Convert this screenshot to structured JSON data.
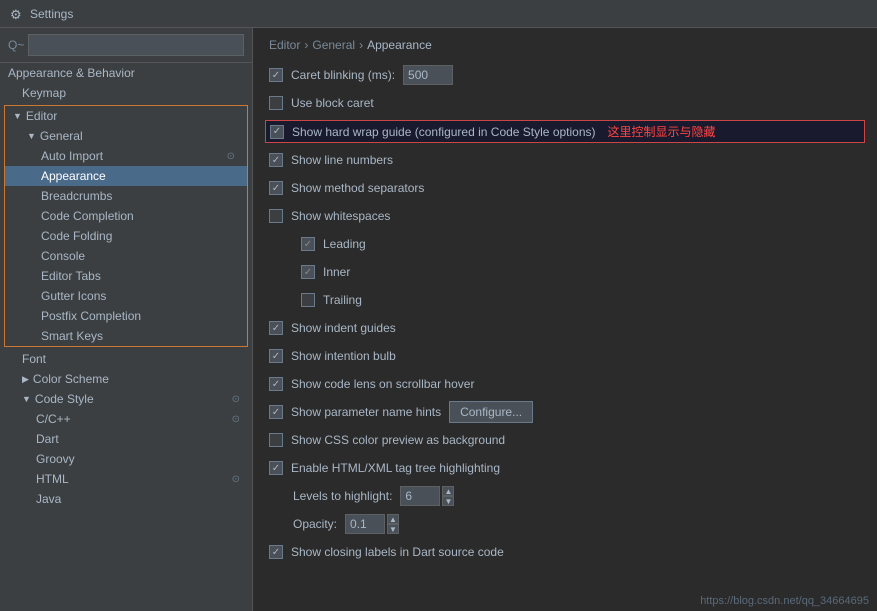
{
  "titleBar": {
    "title": "Settings",
    "icon": "⚙"
  },
  "sidebar": {
    "searchPlaceholder": "Q~",
    "items": [
      {
        "id": "appearance-behavior",
        "label": "Appearance & Behavior",
        "level": 0,
        "expanded": true,
        "hasArrow": false
      },
      {
        "id": "keymap",
        "label": "Keymap",
        "level": 1,
        "hasArrow": false
      },
      {
        "id": "editor",
        "label": "Editor",
        "level": 0,
        "expanded": true,
        "hasArrow": true,
        "highlighted": true
      },
      {
        "id": "general",
        "label": "General",
        "level": 1,
        "expanded": true,
        "hasArrow": true
      },
      {
        "id": "auto-import",
        "label": "Auto Import",
        "level": 2,
        "hasArrow": false,
        "hasRightIcon": true
      },
      {
        "id": "appearance",
        "label": "Appearance",
        "level": 2,
        "selected": true
      },
      {
        "id": "breadcrumbs",
        "label": "Breadcrumbs",
        "level": 2
      },
      {
        "id": "code-completion",
        "label": "Code Completion",
        "level": 2
      },
      {
        "id": "code-folding",
        "label": "Code Folding",
        "level": 2
      },
      {
        "id": "console",
        "label": "Console",
        "level": 2
      },
      {
        "id": "editor-tabs",
        "label": "Editor Tabs",
        "level": 2
      },
      {
        "id": "gutter-icons",
        "label": "Gutter Icons",
        "level": 2
      },
      {
        "id": "postfix-completion",
        "label": "Postfix Completion",
        "level": 2
      },
      {
        "id": "smart-keys",
        "label": "Smart Keys",
        "level": 2
      },
      {
        "id": "font",
        "label": "Font",
        "level": 1
      },
      {
        "id": "color-scheme",
        "label": "Color Scheme",
        "level": 1,
        "hasArrow": false,
        "collapsed": true
      },
      {
        "id": "code-style",
        "label": "Code Style",
        "level": 1,
        "expanded": true,
        "hasArrow": true,
        "hasRightIcon": true
      },
      {
        "id": "cpp",
        "label": "C/C++",
        "level": 2,
        "hasRightIcon": true
      },
      {
        "id": "dart",
        "label": "Dart",
        "level": 2
      },
      {
        "id": "groovy",
        "label": "Groovy",
        "level": 2
      },
      {
        "id": "html",
        "label": "HTML",
        "level": 2,
        "hasRightIcon": true
      },
      {
        "id": "java",
        "label": "Java",
        "level": 2
      }
    ]
  },
  "content": {
    "breadcrumb": [
      "Editor",
      "General",
      "Appearance"
    ],
    "breadcrumbSeparator": "›",
    "settings": [
      {
        "id": "caret-blinking",
        "type": "checkbox-input",
        "checked": true,
        "label": "Caret blinking (ms):",
        "value": "500"
      },
      {
        "id": "use-block-caret",
        "type": "checkbox",
        "checked": false,
        "label": "Use block caret"
      },
      {
        "id": "show-hard-wrap",
        "type": "checkbox",
        "checked": true,
        "label": "Show hard wrap guide (configured in Code Style options)",
        "highlighted": true
      },
      {
        "id": "show-line-numbers",
        "type": "checkbox",
        "checked": true,
        "label": "Show line numbers"
      },
      {
        "id": "show-method-separators",
        "type": "checkbox",
        "checked": true,
        "label": "Show method separators"
      },
      {
        "id": "show-whitespaces",
        "type": "checkbox",
        "checked": false,
        "label": "Show whitespaces"
      },
      {
        "id": "leading",
        "type": "checkbox-sub",
        "checked": true,
        "label": "Leading",
        "partial": true
      },
      {
        "id": "inner",
        "type": "checkbox-sub",
        "checked": true,
        "label": "Inner",
        "partial": true
      },
      {
        "id": "trailing",
        "type": "checkbox-sub",
        "checked": false,
        "label": "Trailing"
      },
      {
        "id": "show-indent-guides",
        "type": "checkbox",
        "checked": true,
        "label": "Show indent guides"
      },
      {
        "id": "show-intention-bulb",
        "type": "checkbox",
        "checked": true,
        "label": "Show intention bulb"
      },
      {
        "id": "show-code-lens",
        "type": "checkbox",
        "checked": true,
        "label": "Show code lens on scrollbar hover"
      },
      {
        "id": "show-parameter-hints",
        "type": "checkbox-button",
        "checked": true,
        "label": "Show parameter name hints",
        "buttonLabel": "Configure..."
      },
      {
        "id": "show-css-color",
        "type": "checkbox",
        "checked": false,
        "label": "Show CSS color preview as background"
      },
      {
        "id": "enable-html-xml",
        "type": "checkbox",
        "checked": true,
        "label": "Enable HTML/XML tag tree highlighting"
      },
      {
        "id": "levels-to-highlight",
        "type": "label-spinner",
        "label": "Levels to highlight:",
        "value": "6"
      },
      {
        "id": "opacity",
        "type": "label-spinner",
        "label": "Opacity:",
        "value": "0.1"
      },
      {
        "id": "show-closing-labels",
        "type": "checkbox",
        "checked": true,
        "label": "Show closing labels in Dart source code"
      }
    ],
    "chineseNote": "这里控制显示与隐藏",
    "footerUrl": "https://blog.csdn.net/qq_34664695"
  }
}
